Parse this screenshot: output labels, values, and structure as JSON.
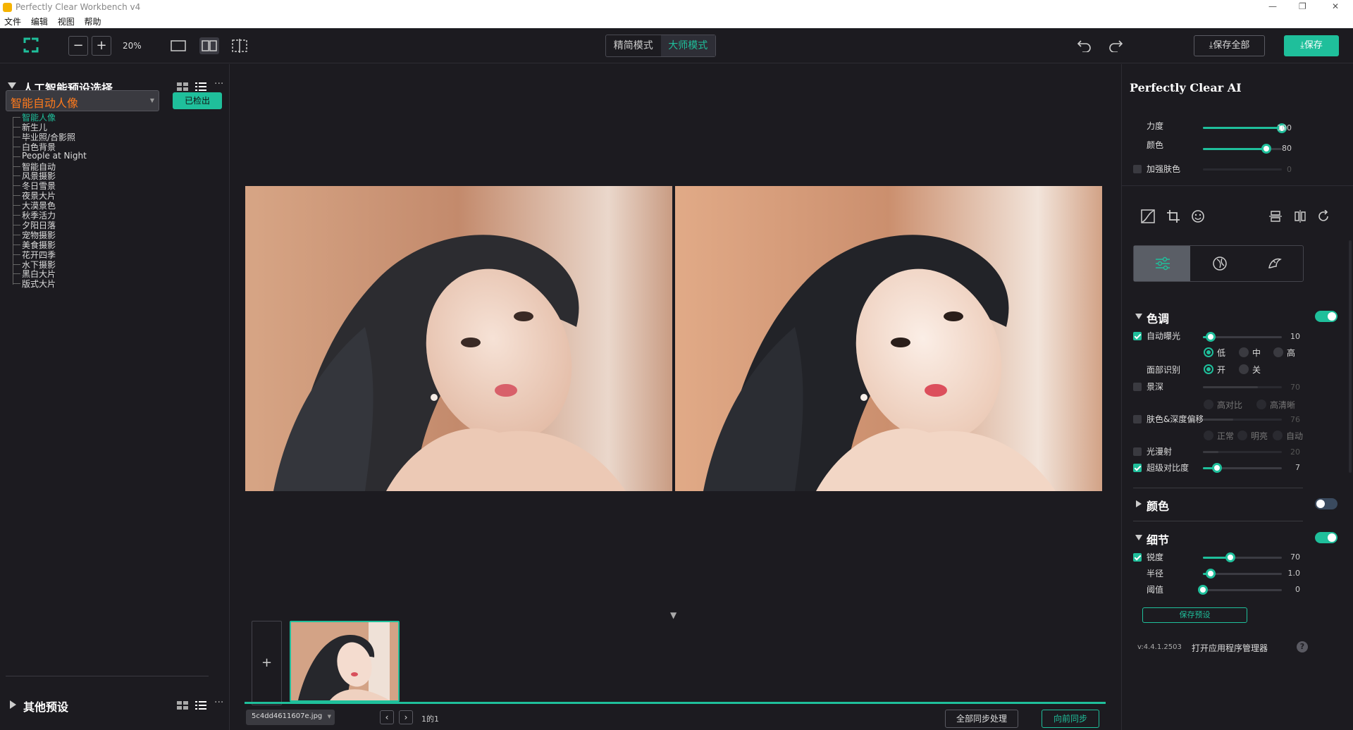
{
  "window": {
    "title": "Perfectly Clear Workbench v4",
    "controls": [
      "—",
      "❐",
      "✕"
    ]
  },
  "menu": [
    "文件",
    "编辑",
    "视图",
    "帮助"
  ],
  "toolbar": {
    "zoom_out": "−",
    "zoom_in": "+",
    "zoom": "20%",
    "mode_simple": "精简模式",
    "mode_master": "大师模式",
    "save_all": "保存全部",
    "save": "保存"
  },
  "left": {
    "ai_title": "人工智能预设选择",
    "preset_select": "智能自动人像",
    "detected": "已检出",
    "presets": [
      "智能人像",
      "新生儿",
      "毕业照/合影照",
      "白色背景",
      "People at Night",
      "智能自动",
      "风景摄影",
      "冬日雪景",
      "夜景大片",
      "大漠景色",
      "秋季活力",
      "夕阳日落",
      "宠物摄影",
      "美食摄影",
      "花开四季",
      "水下摄影",
      "黑白大片",
      "版式大片"
    ],
    "other_title": "其他预设"
  },
  "canvas": {
    "add": "+",
    "file_select": "5c4dd4611607e.jpg",
    "page": "1的1",
    "sync_all": "全部同步处理",
    "sync_forward": "向前同步"
  },
  "right": {
    "title": "Perfectly Clear AI",
    "strength_label": "力度",
    "strength": 100,
    "color_label": "颜色",
    "color": 80,
    "skin_label": "加强肤色",
    "skin": 0,
    "tone": {
      "title": "色调",
      "auto_exposure_label": "自动曝光",
      "auto_exposure": 10,
      "low": "低",
      "mid": "中",
      "high": "高",
      "face_label": "面部识别",
      "on": "开",
      "off": "关",
      "depth_label": "景深",
      "depth": 70,
      "hc": "高对比",
      "hd": "高清晰",
      "skin_depth_label": "肤色&深度偏移",
      "skin_depth": 76,
      "normal": "正常",
      "bright": "明亮",
      "auto": "自动",
      "diffuse_label": "光漫射",
      "diffuse": 20,
      "contrast_label": "超级对比度",
      "contrast": 7
    },
    "color_section": {
      "title": "颜色"
    },
    "detail": {
      "title": "细节",
      "sharp_label": "锐度",
      "sharp": 70,
      "radius_label": "半径",
      "radius": "1.0",
      "threshold_label": "阈值",
      "threshold": 0
    },
    "save_preset": "保存预设",
    "version": "v:4.4.1.2503",
    "open_manager": "打开应用程序管理器",
    "help": "?"
  },
  "colors": {
    "accent": "#1fbf9b",
    "bg": "#1c1b20",
    "orange": "#ff7a1c"
  }
}
